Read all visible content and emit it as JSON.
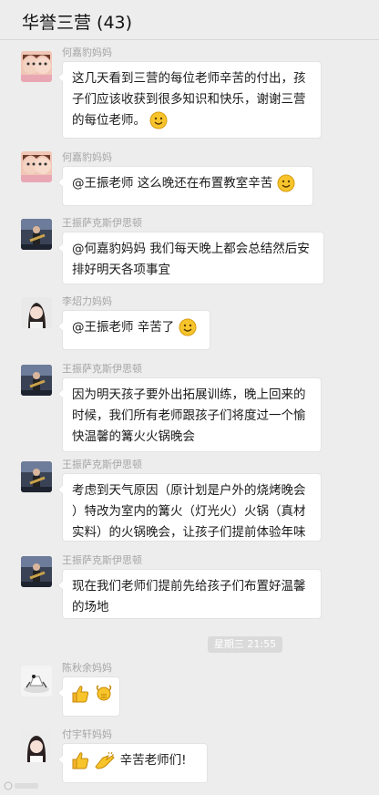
{
  "header": {
    "title": "华誉三营 (43)"
  },
  "messages": [
    {
      "sender": "何嘉豹妈妈",
      "lines": [
        "这几天看到三营的每位老师辛苦的付出，孩",
        "子们应该收获到很多知识和快乐，谢谢三营",
        "的每位老师。"
      ],
      "emoji": "smile-emoji"
    },
    {
      "sender": "何嘉豹妈妈",
      "lines": [
        "@王振老师 这么晚还在布置教室辛苦"
      ],
      "emoji": "smile-emoji"
    },
    {
      "sender": "王振萨克斯伊思顿",
      "lines": [
        "@何嘉豹妈妈 我们每天晚上都会总结然后安",
        "排好明天各项事宜"
      ]
    },
    {
      "sender": "李炤力妈妈",
      "lines": [
        "@王振老师 辛苦了"
      ],
      "emoji": "smile-emoji"
    },
    {
      "sender": "王振萨克斯伊思顿",
      "lines": [
        "因为明天孩子要外出拓展训练，晚上回来的",
        "时候，我们所有老师跟孩子们将度过一个愉",
        "快温馨的篝火火锅晚会"
      ]
    },
    {
      "sender": "王振萨克斯伊思顿",
      "lines": [
        "考虑到天气原因（原计划是户外的烧烤晚会",
        "）特改为室内的篝火（灯光火）火锅（真材",
        "实料）的火锅晚会，让孩子们提前体验年味"
      ]
    },
    {
      "sender": "王振萨克斯伊思顿",
      "lines": [
        "现在我们老师们提前先给孩子们布置好温馨",
        "的场地"
      ]
    }
  ],
  "timestamp": "星期三 21:55",
  "emoji_messages": [
    {
      "sender": "陈秋余妈妈",
      "emojis": [
        "thumbs-up-emoji",
        "fist-salute-emoji"
      ]
    },
    {
      "sender": "付宇轩妈妈",
      "emojis": [
        "thumbs-up-emoji",
        "clapping-hands-emoji"
      ],
      "text": "辛苦老师们!"
    }
  ],
  "colors": {
    "background": "#ededed",
    "bubble": "#ffffff",
    "sender_name": "#a6a6a6",
    "emoji_yellow": "#f7c52b"
  }
}
